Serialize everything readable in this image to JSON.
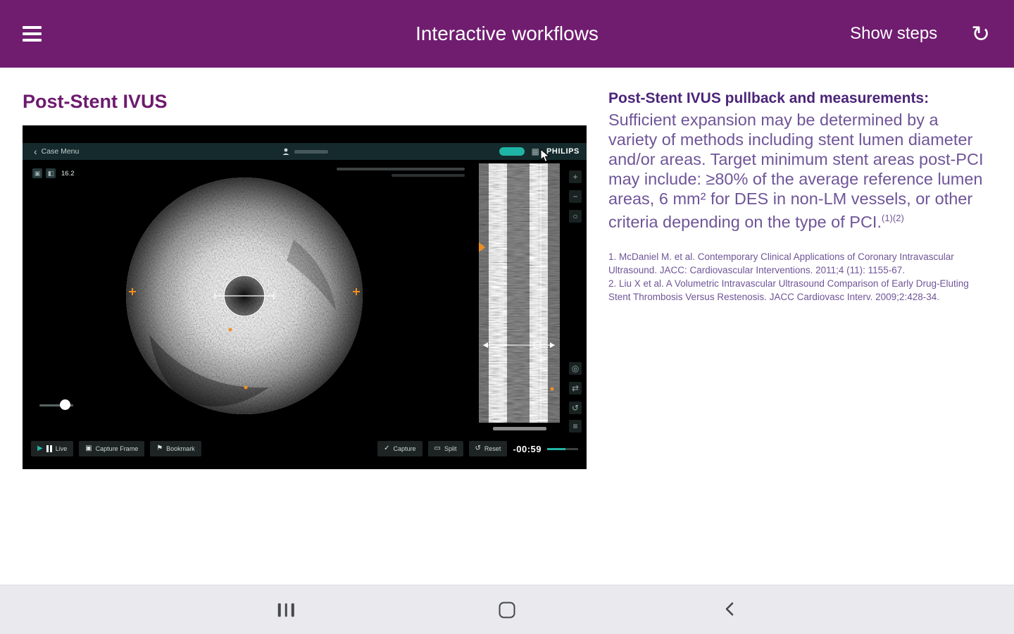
{
  "app_bar": {
    "title": "Interactive workflows",
    "show_steps_label": "Show steps",
    "refresh_icon": "↻"
  },
  "page": {
    "heading": "Post-Stent IVUS"
  },
  "ivus_player": {
    "top_bar": {
      "back_chevron": "‹",
      "back_label": "Case Menu",
      "brand": "PHILIPS",
      "grid_icon": "▦"
    },
    "display": {
      "frequency_label": "16.2"
    },
    "timer": "-00:59",
    "controls_left": [
      {
        "icon": "▶",
        "label": "Live"
      },
      {
        "icon": "▣",
        "label": "Capture Frame"
      },
      {
        "icon": "⚑",
        "label": "Bookmark"
      }
    ],
    "controls_right": [
      {
        "icon": "✓",
        "label": "Capture"
      },
      {
        "icon": "▭",
        "label": "Split"
      },
      {
        "icon": "↺",
        "label": "Reset"
      }
    ],
    "side_tools": [
      "+",
      "−",
      "○",
      "◎",
      "⇄",
      "↺",
      "≡"
    ],
    "accent_color": "#1fb5a6"
  },
  "article": {
    "heading": "Post-Stent IVUS pullback and measurements:",
    "body": "Sufficient expansion may be determined by a variety of methods including stent lumen diameter and/or areas. Target minimum stent areas post-PCI may include: ≥80% of the average reference lumen areas, 6 mm² for DES in non-LM vessels, or other criteria depending on the type of PCI.",
    "citation_marks": "(1)(2)",
    "references": [
      "1. McDaniel M. et al. Contemporary Clinical Applications of Coronary Intravascular Ultrasound. JACC: Cardiovascular Interventions. 2011;4 (11): 1155-67.",
      "2. Liu X et al. A Volumetric Intravascular Ultrasound Comparison of Early Drug-Eluting Stent Thrombosis Versus Restenosis. JACC Cardiovasc Interv. 2009;2:428-34."
    ]
  },
  "colors": {
    "header_purple": "#701d70",
    "heading_purple": "#6e1a6e",
    "text_purple": "#6f5598",
    "accent_teal": "#1fb5a6"
  }
}
